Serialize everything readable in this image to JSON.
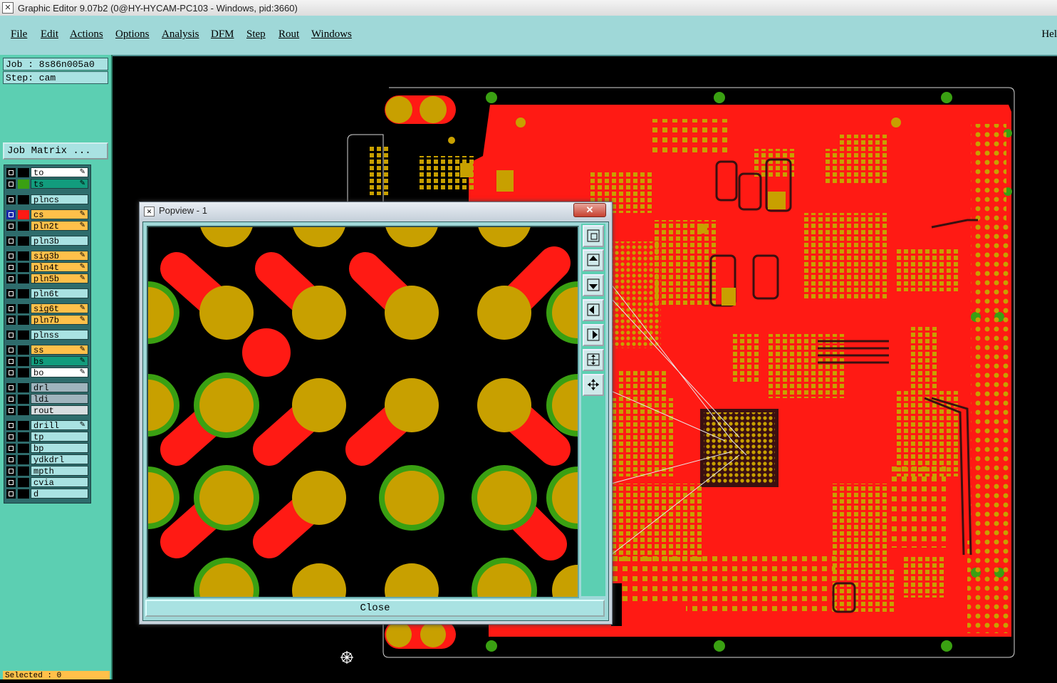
{
  "window": {
    "title": "Graphic Editor 9.07b2 (0@HY-HYCAM-PC103 - Windows, pid:3660)"
  },
  "menu": [
    "File",
    "Edit",
    "Actions",
    "Options",
    "Analysis",
    "DFM",
    "Step",
    "Rout",
    "Windows"
  ],
  "help": "Hel",
  "job": {
    "job_line": "Job : 8s86n005a0",
    "step_line": "Step: cam",
    "matrix_button": "Job Matrix ..."
  },
  "layers": [
    {
      "name": "to",
      "color": "#ffffff"
    },
    {
      "name": "ts",
      "color": "#129c7d"
    },
    {
      "name": "plncs",
      "color": "#a9e2e2"
    },
    {
      "name": "cs",
      "color": "#ffc04a"
    },
    {
      "name": "pln2t",
      "color": "#ffc04a"
    },
    {
      "name": "pln3b",
      "color": "#a9e2e2"
    },
    {
      "name": "sig3b",
      "color": "#ffc04a"
    },
    {
      "name": "pln4t",
      "color": "#ffc04a"
    },
    {
      "name": "pln5b",
      "color": "#ffc04a"
    },
    {
      "name": "pln6t",
      "color": "#a9e2e2"
    },
    {
      "name": "sig6t",
      "color": "#ffc04a"
    },
    {
      "name": "pln7b",
      "color": "#ffc04a"
    },
    {
      "name": "plnss",
      "color": "#a9e2e2"
    },
    {
      "name": "ss",
      "color": "#ffc04a"
    },
    {
      "name": "bs",
      "color": "#129c7d"
    },
    {
      "name": "bo",
      "color": "#ffffff"
    },
    {
      "name": "drl",
      "color": "#9fb4bd"
    },
    {
      "name": "ldi",
      "color": "#9fb4bd"
    },
    {
      "name": "rout",
      "color": "#d7dde0"
    },
    {
      "name": "drill",
      "color": "#a9e2e2"
    },
    {
      "name": "tp",
      "color": "#a9e2e2"
    },
    {
      "name": "bp",
      "color": "#a9e2e2"
    },
    {
      "name": "ydkdrl",
      "color": "#a9e2e2"
    },
    {
      "name": "mpth",
      "color": "#a9e2e2"
    },
    {
      "name": "cvia",
      "color": "#a9e2e2"
    },
    {
      "name": "d",
      "color": "#a9e2e2"
    }
  ],
  "status": {
    "selected": "Selected : 0"
  },
  "popview": {
    "title": "Popview - 1",
    "close_label": "Close"
  },
  "colors": {
    "board_red": "#ff1a14",
    "pad_gold": "#c8a000",
    "via_green": "#3aa012",
    "menu_bg": "#9fd8d8",
    "panel_bg": "#5ccfb2"
  },
  "icons": [
    "popview-fit-icon",
    "pan-up-icon",
    "pan-down-icon",
    "pan-left-icon",
    "pan-right-icon",
    "zoom-fit-icon",
    "zoom-extents-icon",
    "crosshair-cursor-icon"
  ]
}
